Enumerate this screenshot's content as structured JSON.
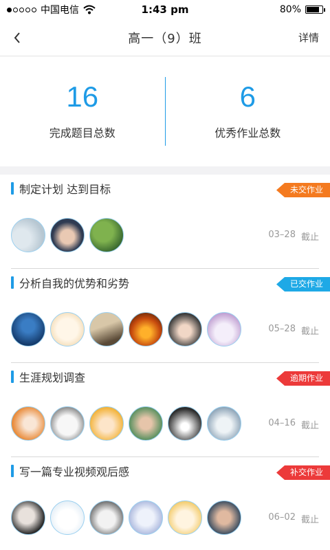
{
  "status_bar": {
    "carrier": "中国电信",
    "time": "1:43 pm",
    "battery": "80%",
    "battery_level": 0.8
  },
  "nav": {
    "title": "高一（9）班",
    "detail": "详情"
  },
  "stats": [
    {
      "value": "16",
      "label": "完成题目总数"
    },
    {
      "value": "6",
      "label": "优秀作业总数"
    }
  ],
  "deadline_suffix": "截止",
  "colors": {
    "accent": "#1e9be6",
    "not_submitted": "#f47a1f",
    "submitted": "#1ea9e6",
    "overdue": "#ec3a3a",
    "late_submit": "#ec3a3a"
  },
  "tasks": [
    {
      "title": "制定计划 达到目标",
      "status": "未交作业",
      "status_color": "#f47a1f",
      "date": "03–28",
      "avatars": [
        "avatar-dandelion",
        "avatar-boy-hood",
        "avatar-tree"
      ]
    },
    {
      "title": "分析自我的优势和劣势",
      "status": "已交作业",
      "status_color": "#1ea9e6",
      "date": "05–28",
      "avatars": [
        "avatar-night-sky",
        "avatar-cartoon-fox",
        "avatar-classroom",
        "avatar-sunset",
        "avatar-girl-sunglasses",
        "avatar-white-dog"
      ]
    },
    {
      "title": "生涯规划调查",
      "status": "逾期作业",
      "status_color": "#ec3a3a",
      "date": "04–16",
      "avatars": [
        "avatar-redhead-girl",
        "avatar-girl-sketch",
        "avatar-anime-girl",
        "avatar-girl-green",
        "avatar-boy-flower",
        "avatar-totoro"
      ]
    },
    {
      "title": "写一篇专业视频观后感",
      "status": "补交作业",
      "status_color": "#ec3a3a",
      "date": "06–02",
      "avatars": [
        "avatar-man-dark",
        "avatar-rabbit",
        "avatar-boy-sketch",
        "avatar-anime-silver",
        "avatar-cartoon-girl",
        "avatar-man-beard"
      ]
    }
  ]
}
